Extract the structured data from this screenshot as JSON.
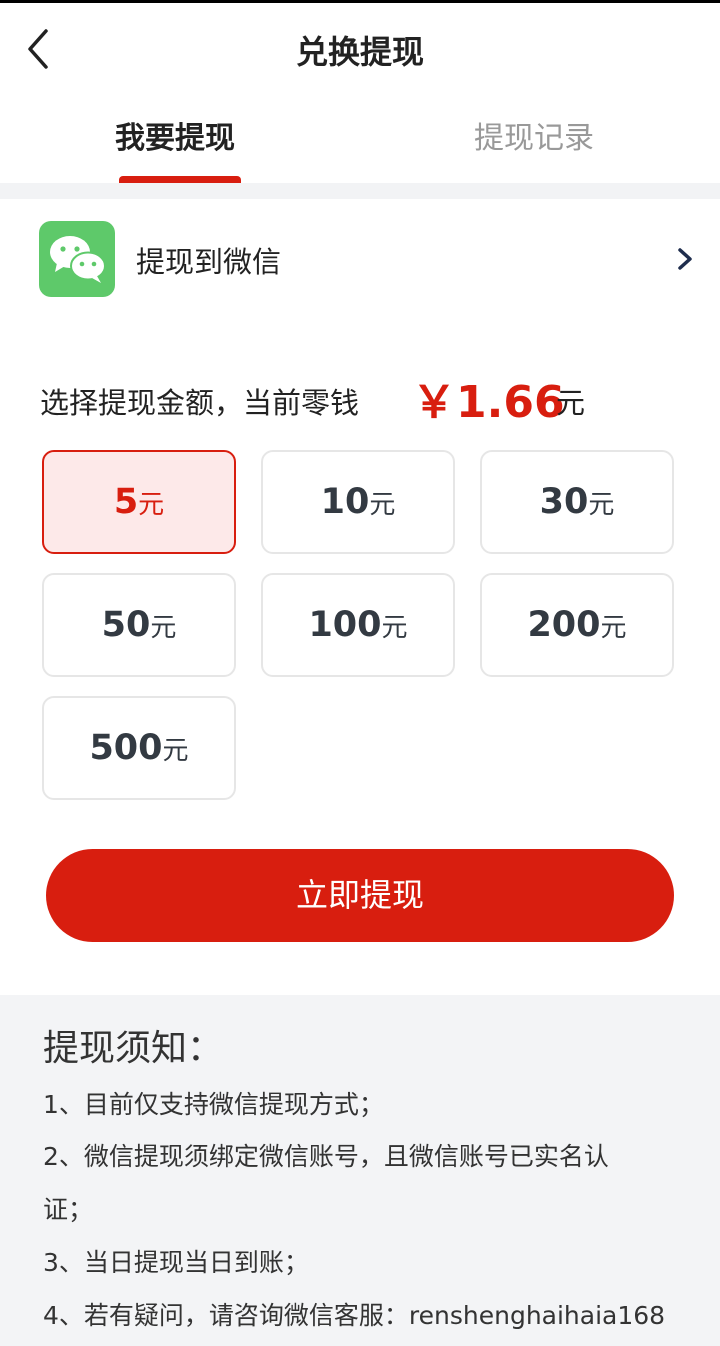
{
  "header": {
    "title": "兑换提现",
    "back_icon": "chevron-left-icon"
  },
  "tabs": [
    {
      "label": "我要提现",
      "active": true
    },
    {
      "label": "提现记录",
      "active": false
    }
  ],
  "wechat": {
    "label": "提现到微信",
    "icon": "wechat-icon",
    "chevron": "chevron-right-icon"
  },
  "balance": {
    "label": "选择提现金额，当前零钱",
    "amount": "￥1.66",
    "unit": "元"
  },
  "amounts": [
    {
      "value": "5",
      "unit": "元",
      "selected": true
    },
    {
      "value": "10",
      "unit": "元",
      "selected": false
    },
    {
      "value": "30",
      "unit": "元",
      "selected": false
    },
    {
      "value": "50",
      "unit": "元",
      "selected": false
    },
    {
      "value": "100",
      "unit": "元",
      "selected": false
    },
    {
      "value": "200",
      "unit": "元",
      "selected": false
    },
    {
      "value": "500",
      "unit": "元",
      "selected": false
    }
  ],
  "withdraw_button": "立即提现",
  "notice": {
    "title": "提现须知：",
    "items": [
      "1、目前仅支持微信提现方式；",
      "2、微信提现须绑定微信账号，且微信账号已实名认",
      "证；",
      "3、当日提现当日到账；",
      "4、若有疑问，请咨询微信客服：renshenghaihaia168"
    ]
  },
  "colors": {
    "accent": "#d81e0f",
    "selected_bg": "#fde9e9",
    "wechat_green": "#5ec96a",
    "notice_bg": "#f3f4f6"
  }
}
